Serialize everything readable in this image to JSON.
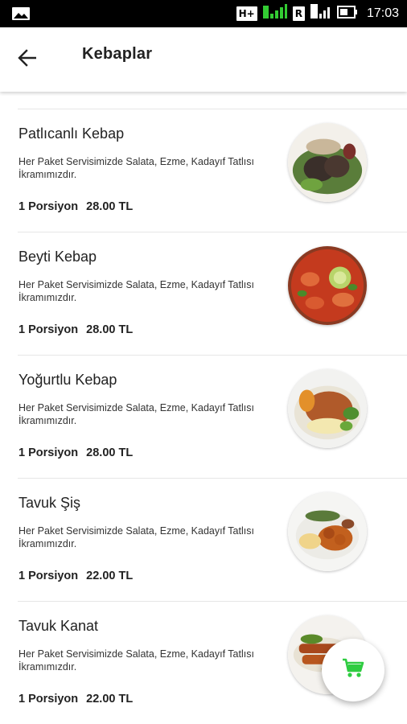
{
  "status_bar": {
    "network_label": "H+",
    "network2_label": "R",
    "time": "17:03"
  },
  "header": {
    "title": "Kebaplar",
    "back_icon": "arrow-back-icon"
  },
  "menu": {
    "items": [
      {
        "name": "Patlıcanlı Kebap",
        "description": "Her Paket Servisimizde Salata, Ezme, Kadayıf Tatlısı İkramımızdır.",
        "unit": "1 Porsiyon",
        "price": "28.00 TL"
      },
      {
        "name": "Beyti Kebap",
        "description": "Her Paket Servisimizde Salata, Ezme, Kadayıf Tatlısı İkramımızdır.",
        "unit": "1 Porsiyon",
        "price": "28.00 TL"
      },
      {
        "name": "Yoğurtlu Kebap",
        "description": "Her Paket Servisimizde Salata, Ezme, Kadayıf Tatlısı İkramımızdır.",
        "unit": "1 Porsiyon",
        "price": "28.00 TL"
      },
      {
        "name": "Tavuk Şiş",
        "description": "Her Paket Servisimizde Salata, Ezme, Kadayıf Tatlısı İkramımızdır.",
        "unit": "1 Porsiyon",
        "price": "22.00 TL"
      },
      {
        "name": "Tavuk Kanat",
        "description": "Her Paket Servisimizde Salata, Ezme, Kadayıf Tatlısı İkramımızdır.",
        "unit": "1 Porsiyon",
        "price": "22.00 TL"
      }
    ]
  },
  "cart_button": {
    "icon": "cart-icon",
    "color": "#2ecc40"
  },
  "colors": {
    "accent": "#2ecc40",
    "text": "#222222",
    "divider": "#e6e6e6"
  }
}
